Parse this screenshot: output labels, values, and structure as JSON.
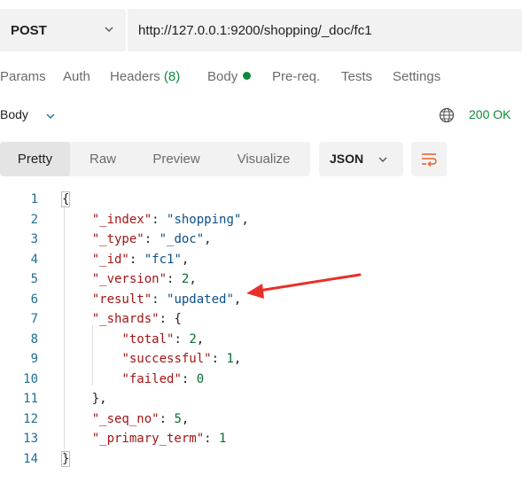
{
  "request": {
    "method": "POST",
    "url": "http://127.0.0.1:9200/shopping/_doc/fc1"
  },
  "request_tabs": {
    "params": "Params",
    "auth": "Auth",
    "headers": "Headers",
    "headers_count": "(8)",
    "body": "Body",
    "prereq": "Pre-req.",
    "tests": "Tests",
    "settings": "Settings"
  },
  "response": {
    "section_label": "Body",
    "status": "200 OK",
    "view_tabs": [
      "Pretty",
      "Raw",
      "Preview",
      "Visualize"
    ],
    "active_view": "Pretty",
    "format": "JSON"
  },
  "code": {
    "line_numbers": [
      "1",
      "2",
      "3",
      "4",
      "5",
      "6",
      "7",
      "8",
      "9",
      "10",
      "11",
      "12",
      "13",
      "14"
    ],
    "open_brace": "{",
    "close_brace": "}",
    "index_key": "\"_index\"",
    "index_val": "\"shopping\"",
    "type_key": "\"_type\"",
    "type_val": "\"_doc\"",
    "id_key": "\"_id\"",
    "id_val": "\"fc1\"",
    "version_key": "\"_version\"",
    "version_val": "2",
    "result_key": "\"result\"",
    "result_val": "\"updated\"",
    "shards_key": "\"_shards\"",
    "shards_open": "{",
    "total_key": "\"total\"",
    "total_val": "2",
    "successful_key": "\"successful\"",
    "successful_val": "1",
    "failed_key": "\"failed\"",
    "failed_val": "0",
    "shards_close": "},",
    "seq_key": "\"_seq_no\"",
    "seq_val": "5",
    "primary_key": "\"_primary_term\"",
    "primary_val": "1"
  },
  "colors": {
    "accent_green": "#0f8a3a",
    "annotation_arrow": "#e8302b",
    "wrap_icon": "#e8612c"
  },
  "icons": [
    "chevron-down-icon",
    "globe-icon",
    "wrap-lines-icon",
    "red-annotation-arrow"
  ]
}
